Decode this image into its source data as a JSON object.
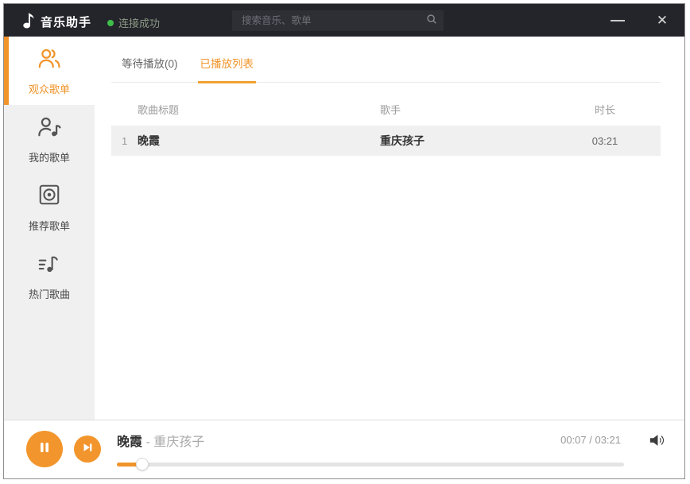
{
  "window": {
    "title": "音乐助手",
    "status_label": "连接成功",
    "search_placeholder": "搜索音乐、歌单",
    "controls": {
      "minimize": "—",
      "close": "✕"
    }
  },
  "sidebar": {
    "items": [
      {
        "label": "观众歌单",
        "icon": "audience-playlist-icon",
        "active": true
      },
      {
        "label": "我的歌单",
        "icon": "my-playlist-icon",
        "active": false
      },
      {
        "label": "推荐歌单",
        "icon": "recommended-playlist-icon",
        "active": false
      },
      {
        "label": "热门歌曲",
        "icon": "hot-songs-icon",
        "active": false
      }
    ]
  },
  "tabs": [
    {
      "label": "等待播放(0)",
      "active": false
    },
    {
      "label": "已播放列表",
      "active": true
    }
  ],
  "table": {
    "columns": {
      "title": "歌曲标题",
      "artist": "歌手",
      "duration": "时长"
    },
    "rows": [
      {
        "index": "1",
        "title": "晚霞",
        "artist": "重庆孩子",
        "duration": "03:21"
      }
    ]
  },
  "player": {
    "title": "晚霞",
    "dash": "-",
    "artist": "重庆孩子",
    "time_display": "00:07 / 03:21",
    "progress_percent": 5
  },
  "colors": {
    "accent_orange": "#F0942A",
    "titlebar_dark": "#24242B",
    "status_green": "#3FBF4A",
    "sidebar_gray": "#F0F0F0",
    "row_gray": "#F0F0F0"
  }
}
